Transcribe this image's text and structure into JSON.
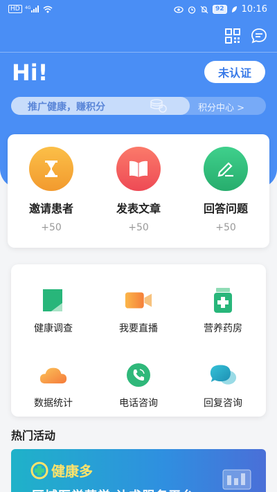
{
  "status_bar": {
    "network": "HD",
    "signal": "4G",
    "battery": "92",
    "time": "10:16"
  },
  "header": {
    "greeting": "Hi!",
    "auth_button": "未认证",
    "promo_text": "推广健康，赚积分",
    "points_link": "积分中心 >"
  },
  "tasks": [
    {
      "label": "邀请患者",
      "points": "+50",
      "icon": "hourglass-icon",
      "color": "#f6a83a"
    },
    {
      "label": "发表文章",
      "points": "+50",
      "icon": "book-icon",
      "color": "#f05a5a"
    },
    {
      "label": "回答问题",
      "points": "+50",
      "icon": "pencil-icon",
      "color": "#2fb87a"
    }
  ],
  "services": [
    {
      "label": "健康调查",
      "icon": "survey-icon"
    },
    {
      "label": "我要直播",
      "icon": "video-camera-icon"
    },
    {
      "label": "营养药房",
      "icon": "medicine-bottle-icon"
    },
    {
      "label": "数据统计",
      "icon": "cloud-icon"
    },
    {
      "label": "电话咨询",
      "icon": "phone-icon"
    },
    {
      "label": "回复咨询",
      "icon": "chat-bubble-icon"
    }
  ],
  "section": {
    "hot_activities": "热门活动"
  },
  "banner": {
    "title": "健康多",
    "subtitle": "区域医学药学 让求服务平台"
  }
}
